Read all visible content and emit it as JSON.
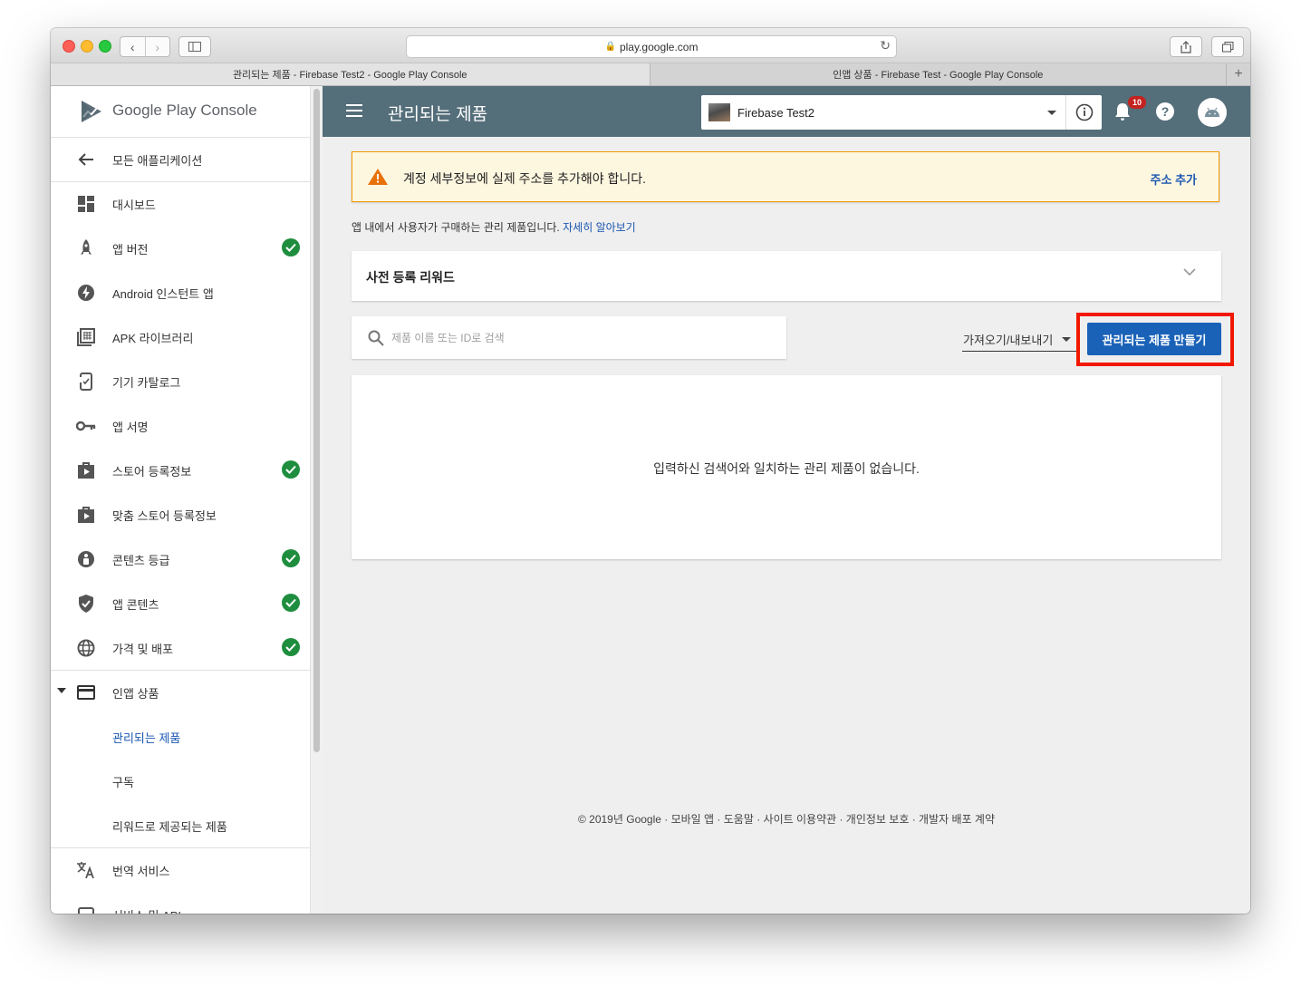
{
  "browser": {
    "url": "play.google.com",
    "tabs": [
      {
        "title": "관리되는 제품 - Firebase Test2 - Google Play Console",
        "active": true
      },
      {
        "title": "인앱 상품 - Firebase Test - Google Play Console",
        "active": false
      }
    ]
  },
  "brand": {
    "google_play": "Google Play",
    "console": "Console"
  },
  "sidebar": {
    "back_label": "모든 애플리케이션",
    "items": [
      {
        "label": "대시보드",
        "icon": "dashboard-icon",
        "checked": false
      },
      {
        "label": "앱 버전",
        "icon": "rocket-icon",
        "checked": true
      },
      {
        "label": "Android 인스턴트 앱",
        "icon": "bolt-icon",
        "checked": false
      },
      {
        "label": "APK 라이브러리",
        "icon": "library-icon",
        "checked": false
      },
      {
        "label": "기기 카탈로그",
        "icon": "device-icon",
        "checked": false
      },
      {
        "label": "앱 서명",
        "icon": "key-icon",
        "checked": false
      },
      {
        "label": "스토어 등록정보",
        "icon": "store-icon",
        "checked": true
      },
      {
        "label": "맞춤 스토어 등록정보",
        "icon": "store-icon",
        "checked": false
      },
      {
        "label": "콘텐츠 등급",
        "icon": "rating-icon",
        "checked": true
      },
      {
        "label": "앱 콘텐츠",
        "icon": "shield-icon",
        "checked": true
      },
      {
        "label": "가격 및 배포",
        "icon": "globe-icon",
        "checked": true
      }
    ],
    "inapp": {
      "label": "인앱 상품",
      "sub": [
        "관리되는 제품",
        "구독",
        "리워드로 제공되는 제품"
      ]
    },
    "more": [
      {
        "label": "번역 서비스",
        "icon": "translate-icon"
      },
      {
        "label": "서비스 및 API",
        "icon": "api-icon"
      }
    ]
  },
  "appbar": {
    "title": "관리되는 제품",
    "app_name": "Firebase Test2",
    "notification_count": "10",
    "help_glyph": "?"
  },
  "alert": {
    "text": "계정 세부정보에 실제 주소를 추가해야 합니다.",
    "action": "주소 추가"
  },
  "description": {
    "text": "앱 내에서 사용자가 구매하는 관리 제품입니다. ",
    "link": "자세히 알아보기"
  },
  "reward": {
    "title": "사전 등록 리워드"
  },
  "search": {
    "placeholder": "제품 이름 또는 ID로 검색",
    "value": ""
  },
  "import_export": {
    "label": "가져오기/내보내기"
  },
  "create_button": {
    "label": "관리되는 제품 만들기"
  },
  "empty_message": "입력하신 검색어와 일치하는 관리 제품이 없습니다.",
  "footer": "© 2019년 Google · 모바일 앱 · 도움말 · 사이트 이용약관 · 개인정보 보호 · 개발자 배포 계약",
  "colors": {
    "appbar": "#546e7a",
    "primary": "#1a62b8",
    "check": "#1e8e3e",
    "alert_border": "#f29900",
    "highlight": "#f21800"
  }
}
